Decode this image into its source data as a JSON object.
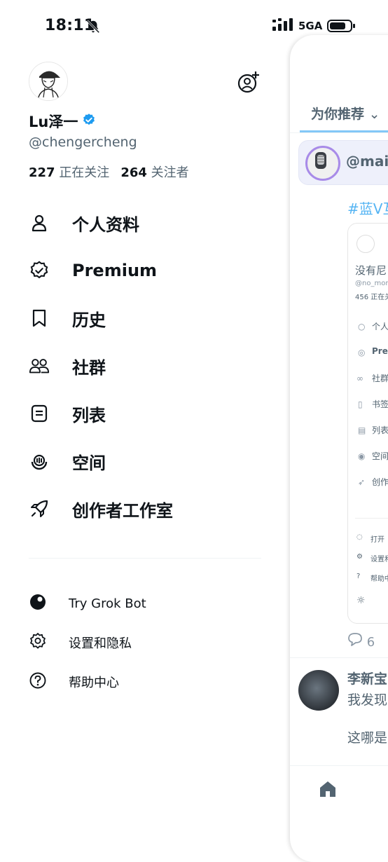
{
  "status_bar": {
    "time": "18:11",
    "network": "5GA"
  },
  "profile": {
    "display_name": "Lu泽一",
    "handle": "@chengercheng",
    "following_count": "227",
    "following_label": "正在关注",
    "followers_count": "264",
    "followers_label": "关注者"
  },
  "menu": [
    {
      "label": "个人资料",
      "icon": "person-icon"
    },
    {
      "label": "Premium",
      "icon": "verified-badge-icon"
    },
    {
      "label": "历史",
      "icon": "bookmark-icon"
    },
    {
      "label": "社群",
      "icon": "people-icon"
    },
    {
      "label": "列表",
      "icon": "list-icon"
    },
    {
      "label": "空间",
      "icon": "spaces-icon"
    },
    {
      "label": "创作者工作室",
      "icon": "rocket-icon"
    }
  ],
  "secondary_menu": [
    {
      "label": "Try Grok Bot",
      "icon": "grok-icon"
    },
    {
      "label": "设置和隐私",
      "icon": "gear-icon"
    },
    {
      "label": "帮助中心",
      "icon": "help-icon"
    }
  ],
  "peek": {
    "tab_label": "为你推荐",
    "space_name": "@maic",
    "hashtag": "#蓝V互",
    "card": {
      "name": "没有尼",
      "handle": "@no_more",
      "stats": "456 正在关",
      "items": [
        "个人",
        "Pre",
        "社群",
        "书签",
        "列表",
        "空间",
        "创作"
      ],
      "footer_items": [
        "打开",
        "设置和",
        "帮助中"
      ]
    },
    "reply_count": "6",
    "post_author": "李新宝",
    "post_text_1": "我发现",
    "post_text_2": "这哪是"
  },
  "colors": {
    "accent": "#1d9bf0",
    "text": "#0f1419",
    "secondary": "#536471"
  }
}
